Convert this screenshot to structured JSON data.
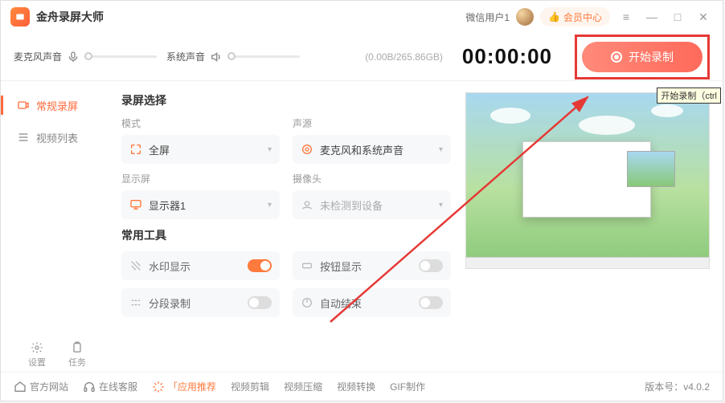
{
  "app": {
    "title": "金舟录屏大师"
  },
  "titlebar": {
    "user": "微信用户1",
    "vip": "会员中心"
  },
  "audio": {
    "mic_label": "麦克风声音",
    "sys_label": "系统声音",
    "storage": "(0.00B/265.86GB)"
  },
  "timer": "00:00:00",
  "record": {
    "label": "开始录制"
  },
  "tooltip": "开始录制（ctrl",
  "sidebar": {
    "items": [
      {
        "label": "常规录屏"
      },
      {
        "label": "视频列表"
      }
    ],
    "tools": [
      {
        "label": "设置"
      },
      {
        "label": "任务"
      }
    ]
  },
  "content": {
    "section1_title": "录屏选择",
    "mode_label": "模式",
    "mode_value": "全屏",
    "source_label": "声源",
    "source_value": "麦克风和系统声音",
    "display_label": "显示屏",
    "display_value": "显示器1",
    "camera_label": "摄像头",
    "camera_value": "未检测到设备",
    "section2_title": "常用工具",
    "watermark": "水印显示",
    "button_show": "按钮显示",
    "segment": "分段录制",
    "auto_end": "自动结束"
  },
  "footer": {
    "site": "官方网站",
    "cs": "在线客服",
    "recommend": "「应用推荐",
    "edit": "视频剪辑",
    "compress": "视频压缩",
    "convert": "视频转换",
    "gif": "GIF制作",
    "version_label": "版本号：",
    "version": "v4.0.2"
  }
}
